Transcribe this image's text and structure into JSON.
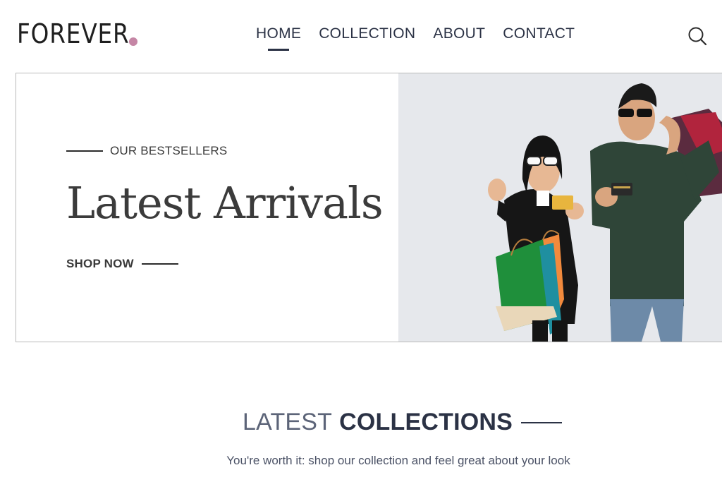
{
  "brand": {
    "name": "FOREVER",
    "dot_color": "#c586a5"
  },
  "nav": {
    "items": [
      {
        "label": "HOME",
        "active": true
      },
      {
        "label": "COLLECTION",
        "active": false
      },
      {
        "label": "ABOUT",
        "active": false
      },
      {
        "label": "CONTACT",
        "active": false
      }
    ],
    "search_icon": "search-icon"
  },
  "hero": {
    "tagline": "OUR BESTSELLERS",
    "title": "Latest Arrivals",
    "cta": "SHOP NOW",
    "image": "couple-with-shopping-bags"
  },
  "collections": {
    "title_light": "LATEST",
    "title_bold": "COLLECTIONS",
    "subtitle": "You're worth it: shop our collection and feel great about your look"
  },
  "colors": {
    "text_dark": "#2b3245",
    "accent": "#c586a5",
    "hero_bg": "#e6e8ec"
  }
}
